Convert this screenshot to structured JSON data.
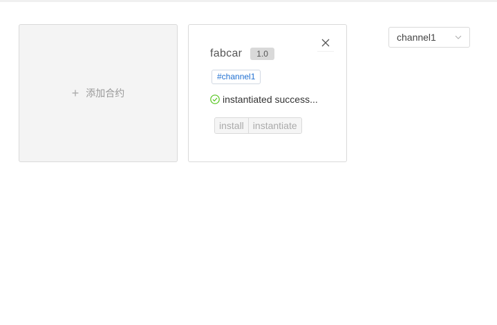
{
  "add_card": {
    "label": "添加合约",
    "icon": "plus-icon"
  },
  "contract": {
    "name": "fabcar",
    "version": "1.0",
    "channel_tag": "#channel1",
    "status": "instantiated success...",
    "status_icon": "check-circle-icon",
    "status_color": "#52c41a",
    "actions": {
      "install_label": "install",
      "instantiate_label": "instantiate"
    },
    "close_icon": "close-icon"
  },
  "channel_select": {
    "value": "channel1",
    "icon": "chevron-down-icon"
  }
}
